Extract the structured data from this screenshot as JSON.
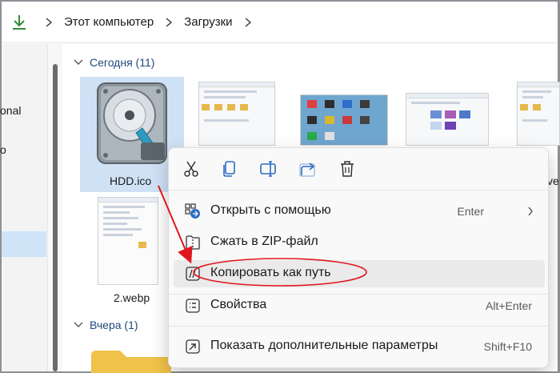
{
  "breadcrumb": {
    "items": [
      "Этот компьютер",
      "Загрузки"
    ]
  },
  "nav": {
    "partial_items": [
      "onal",
      "o"
    ]
  },
  "groups": {
    "today": "Сегодня (11)",
    "yesterday": "Вчера (1)"
  },
  "files": {
    "hdd": "HDD.ico",
    "webp": "2.webp",
    "partial": "ve"
  },
  "context_menu": {
    "toolbar": [
      "cut-icon",
      "copy-icon",
      "rename-icon",
      "share-icon",
      "delete-icon"
    ],
    "items": [
      {
        "label": "Открыть с помощью",
        "shortcut": "Enter",
        "has_submenu": true
      },
      {
        "label": "Сжать в ZIP-файл",
        "shortcut": ""
      },
      {
        "label": "Копировать как путь",
        "shortcut": ""
      },
      {
        "label": "Свойства",
        "shortcut": "Alt+Enter"
      },
      {
        "label": "Показать дополнительные параметры",
        "shortcut": "Shift+F10"
      }
    ]
  },
  "colors": {
    "accent": "#1f4a7a",
    "annotation": "#e0161e",
    "selection": "#cfe1f5"
  }
}
